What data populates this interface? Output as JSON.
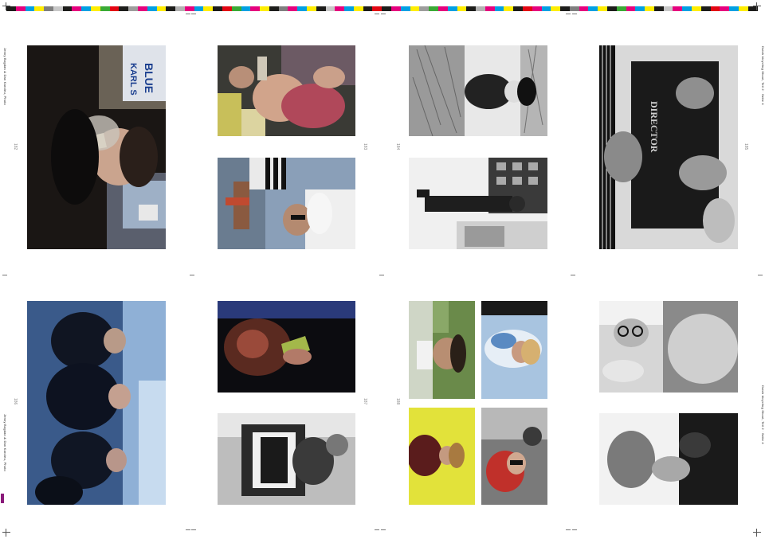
{
  "colorbar": {
    "swatches": [
      "#1d1d1b",
      "#e6007e",
      "#00a0e3",
      "#ffed00",
      "#7f7f7f",
      "#c8c8c8",
      "#1d1d1b",
      "#e6007e",
      "#00a0e3",
      "#ffed00",
      "#3aaa35",
      "#e30613",
      "#1d1d1b",
      "#9d9d9c",
      "#e6007e",
      "#00a0e3",
      "#ffed00",
      "#1d1d1b",
      "#b2b2b2",
      "#e6007e",
      "#00a0e3",
      "#ffed00",
      "#1d1d1b",
      "#e30613",
      "#3aaa35",
      "#00a0e3",
      "#e6007e",
      "#ffed00",
      "#1d1d1b",
      "#7f7f7f",
      "#e6007e",
      "#00a0e3",
      "#ffed00",
      "#1d1d1b",
      "#c8c8c8",
      "#e6007e",
      "#00a0e3",
      "#ffed00",
      "#1d1d1b",
      "#e30613",
      "#1d1d1b",
      "#e6007e",
      "#00a0e3",
      "#ffed00",
      "#9d9d9c",
      "#3aaa35",
      "#e6007e",
      "#00a0e3",
      "#ffed00",
      "#1d1d1b",
      "#b2b2b2",
      "#e6007e",
      "#00a0e3",
      "#ffed00",
      "#1d1d1b",
      "#e30613",
      "#e6007e",
      "#00a0e3",
      "#ffed00",
      "#1d1d1b",
      "#7f7f7f",
      "#e6007e",
      "#00a0e3",
      "#ffed00",
      "#1d1d1b",
      "#3aaa35",
      "#e6007e",
      "#00a0e3",
      "#ffed00",
      "#1d1d1b",
      "#c8c8c8",
      "#e6007e",
      "#00a0e3",
      "#ffed00",
      "#1d1d1b",
      "#e30613",
      "#e6007e",
      "#00a0e3",
      "#ffed00",
      "#1d1d1b"
    ]
  },
  "photos": [
    {
      "id": "man-smoking-bottle",
      "tone": "color-dark"
    },
    {
      "id": "shirtless-man-drinking",
      "tone": "color"
    },
    {
      "id": "woman-crouching-grass",
      "tone": "bw"
    },
    {
      "id": "man-sweatshirt-lying",
      "tone": "bw"
    },
    {
      "id": "man-sunglasses-street",
      "tone": "color"
    },
    {
      "id": "man-walking-street",
      "tone": "bw"
    },
    {
      "id": "band-group-blue",
      "tone": "color-blue"
    },
    {
      "id": "hand-bottle-dark",
      "tone": "color-dark"
    },
    {
      "id": "man-green-room",
      "tone": "color"
    },
    {
      "id": "woman-sky",
      "tone": "color"
    },
    {
      "id": "man-glasses-reaching",
      "tone": "bw"
    },
    {
      "id": "man-motorcycle",
      "tone": "bw"
    },
    {
      "id": "woman-yellow-wall",
      "tone": "color"
    },
    {
      "id": "woman-sunglasses-car",
      "tone": "color"
    },
    {
      "id": "man-hands-face",
      "tone": "bw"
    }
  ],
  "margin_notes": {
    "left_top": "Jenny Bogdan & Dan Karoleu, Photo",
    "left_bottom": "Jenny Bogdan & Dan Karoleu, Photo",
    "right_top": "Dutch bicycling Shoot, Teil 2 · Seite 4",
    "right_bottom": "Dutch bicycling Shoot, Teil 2 · Seite 4"
  },
  "page_numbers": [
    "182",
    "183",
    "184",
    "185",
    "186",
    "187",
    "188"
  ],
  "poster_text": {
    "line1": "KARL S",
    "line2": "BLUE"
  },
  "shirt_text": "DIRECTOR"
}
